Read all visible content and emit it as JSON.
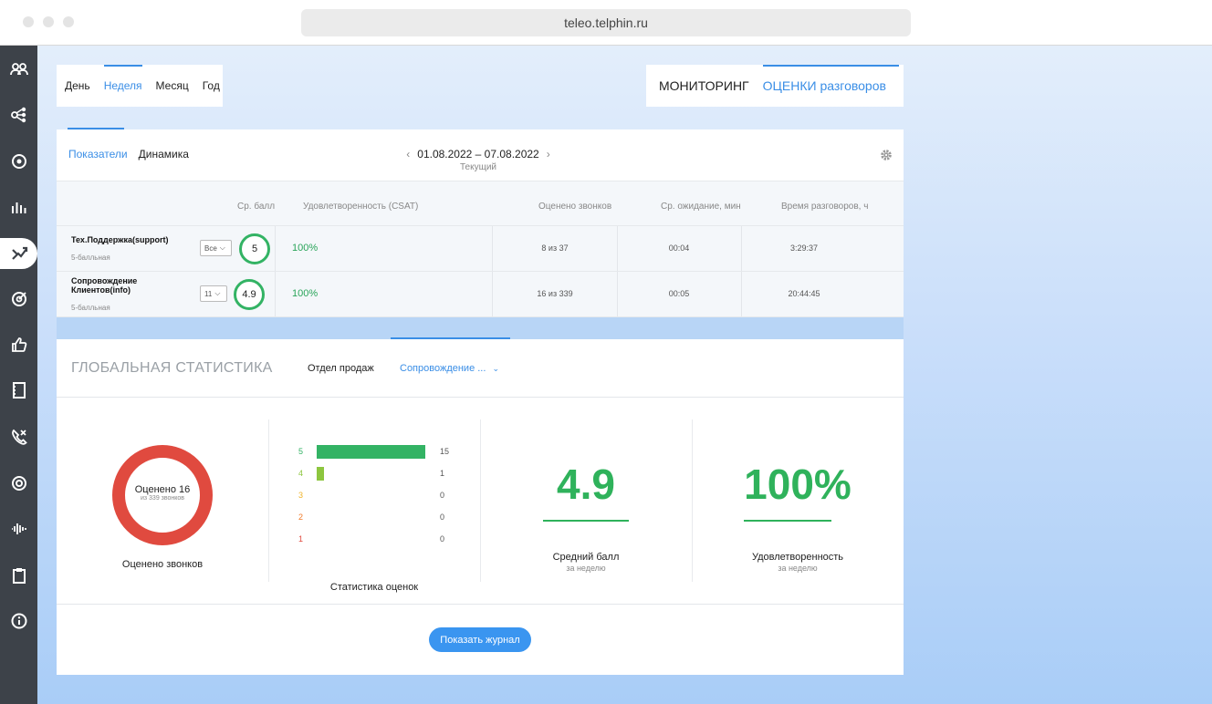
{
  "browser": {
    "url": "teleo.telphin.ru"
  },
  "period_tabs": [
    {
      "label": "День",
      "active": false
    },
    {
      "label": "Неделя",
      "active": true
    },
    {
      "label": "Месяц",
      "active": false
    },
    {
      "label": "Год",
      "active": false
    }
  ],
  "mode_tabs": [
    {
      "label": "МОНИТОРИНГ",
      "active": false
    },
    {
      "label": "ОЦЕНКИ разговоров",
      "active": true
    }
  ],
  "sub_tabs": [
    {
      "label": "Показатели",
      "active": true
    },
    {
      "label": "Динамика",
      "active": false
    }
  ],
  "date_range": {
    "label": "01.08.2022 – 07.08.2022",
    "sub": "Текущий"
  },
  "table": {
    "headers": [
      "Ср. балл",
      "Удовлетворенность (CSAT)",
      "Оценено звонков",
      "Ср. ожидание, мин",
      "Время разговоров, ч"
    ],
    "rows": [
      {
        "name": "Тех.Поддержка(support)",
        "scale": "5-балльная",
        "filter": "Все",
        "score": "5",
        "csat": "100%",
        "rated": "8 из 37",
        "wait": "00:04",
        "talk": "3:29:37"
      },
      {
        "name": "Сопровождение Клиентов(info)",
        "scale": "5-балльная",
        "filter": "11",
        "score": "4.9",
        "csat": "100%",
        "rated": "16 из 339",
        "wait": "00:05",
        "talk": "20:44:45"
      }
    ]
  },
  "global": {
    "title": "ГЛОБАЛЬНАЯ СТАТИСТИКА",
    "tab_sales": "Отдел продаж",
    "tab_support": "Сопровождение ...",
    "donut": {
      "main": "Оценено 16",
      "sub": "из 339 звонков",
      "label": "Оценено звонков"
    },
    "histogram": {
      "label": "Статистика оценок",
      "rows": [
        {
          "grade": "5",
          "count": "15",
          "value": 15,
          "color": "#33b364"
        },
        {
          "grade": "4",
          "count": "1",
          "value": 1,
          "color": "#8dc63f"
        },
        {
          "grade": "3",
          "count": "0",
          "value": 0,
          "color": "#f0b429"
        },
        {
          "grade": "2",
          "count": "0",
          "value": 0,
          "color": "#f07a29"
        },
        {
          "grade": "1",
          "count": "0",
          "value": 0,
          "color": "#e04a3f"
        }
      ],
      "max": 15
    },
    "avg": {
      "value": "4.9",
      "label": "Средний балл",
      "sub": "за неделю"
    },
    "satisfaction": {
      "value": "100%",
      "label": "Удовлетворенность",
      "sub": "за неделю"
    },
    "journal_button": "Показать журнал"
  },
  "colors": {
    "accent": "#3a8ee6",
    "green": "#2fb25b",
    "red": "#e04a3f"
  },
  "sidebar_icons": [
    "users-icon",
    "flow-icon",
    "settings-icon",
    "bar-chart-icon",
    "trending-icon",
    "target-icon",
    "thumbs-up-icon",
    "book-icon",
    "call-missed-icon",
    "record-icon",
    "waveform-icon",
    "clipboard-icon",
    "info-icon"
  ]
}
